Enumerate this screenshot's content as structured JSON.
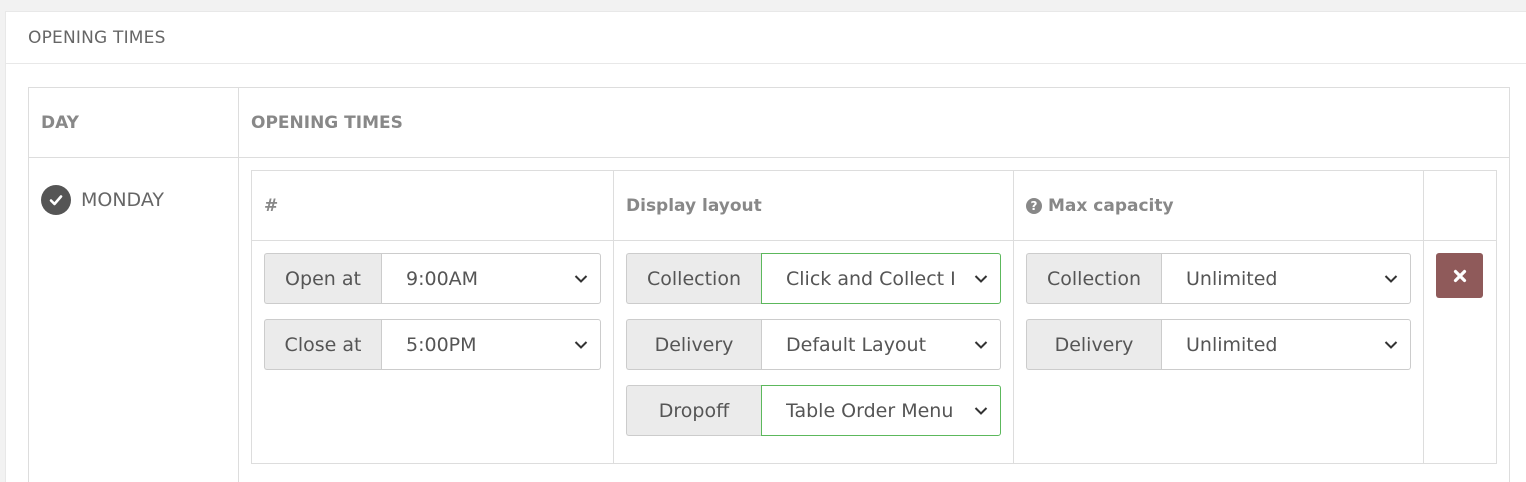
{
  "panel": {
    "title": "OPENING TIMES"
  },
  "table": {
    "headers": {
      "day": "DAY",
      "opening_times": "OPENING TIMES"
    }
  },
  "day": {
    "name": "MONDAY",
    "enabled": true
  },
  "inner": {
    "headers": {
      "index": "#",
      "display_layout": "Display layout",
      "max_capacity": "Max capacity"
    }
  },
  "times": {
    "open": {
      "label": "Open at",
      "value": "9:00AM"
    },
    "close": {
      "label": "Close at",
      "value": "5:00PM"
    }
  },
  "layouts": {
    "collection": {
      "label": "Collection",
      "value": "Click and Collect I"
    },
    "delivery": {
      "label": "Delivery",
      "value": "Default Layout"
    },
    "dropoff": {
      "label": "Dropoff",
      "value": "Table Order Menu"
    }
  },
  "capacity": {
    "collection": {
      "label": "Collection",
      "value": "Unlimited"
    },
    "delivery": {
      "label": "Delivery",
      "value": "Unlimited"
    }
  },
  "colors": {
    "remove_button": "#8f5a5a",
    "highlight_border": "#5cb85c",
    "addon_bg": "#ebebeb"
  },
  "icons": {
    "day_toggle": "check-circle-icon",
    "help": "question-circle-icon",
    "remove": "times-icon",
    "select_caret": "chevron-down-icon"
  }
}
